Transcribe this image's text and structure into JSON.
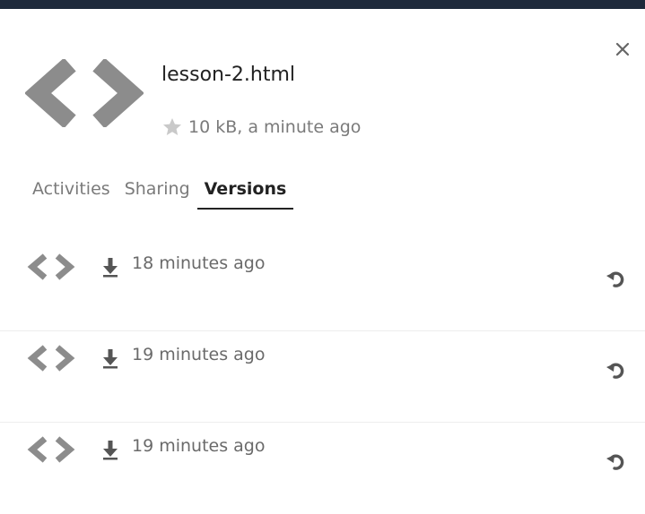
{
  "file": {
    "name": "lesson-2.html",
    "meta": "10 kB, a minute ago",
    "icon": "code-file-icon",
    "starred": false
  },
  "tabs": [
    {
      "label": "Activities",
      "active": false
    },
    {
      "label": "Sharing",
      "active": false
    },
    {
      "label": "Versions",
      "active": true
    }
  ],
  "versions": [
    {
      "time": "18 minutes ago"
    },
    {
      "time": "19 minutes ago"
    },
    {
      "time": "19 minutes ago"
    }
  ],
  "icons": {
    "close": "close-icon",
    "star": "star-icon",
    "download": "download-icon",
    "restore": "restore-icon"
  },
  "colors": {
    "topbar": "#1e2a3b",
    "icon_gray": "#8c8c8c",
    "text_dark": "#222222",
    "text_muted": "#7a7a7a"
  }
}
